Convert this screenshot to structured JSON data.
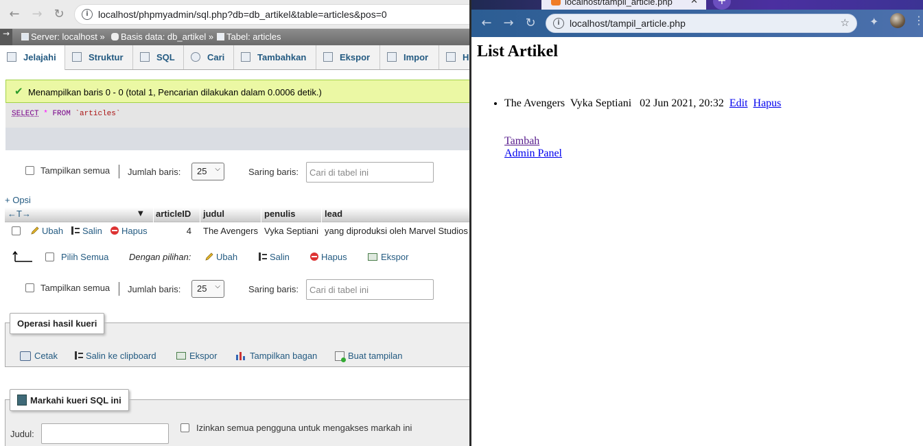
{
  "left_window": {
    "url": "localhost/phpmyadmin/sql.php?db=db_artikel&table=articles&pos=0",
    "breadcrumb": {
      "server": "Server: localhost",
      "database": "Basis data: db_artikel",
      "table": "Tabel: articles"
    },
    "tabs": [
      "Jelajahi",
      "Struktur",
      "SQL",
      "Cari",
      "Tambahkan",
      "Ekspor",
      "Impor",
      "H"
    ],
    "active_tab": "Jelajahi",
    "message": "Menampilkan baris 0 - 0 (total 1, Pencarian dilakukan dalam 0.0006 detik.)",
    "sql": {
      "select": "SELECT",
      "star": "*",
      "from": "FROM",
      "table": "`articles`"
    },
    "nav": {
      "show_all_label": "Tampilkan semua",
      "rows_label": "Jumlah baris:",
      "rows_value": "25",
      "filter_label": "Saring baris:",
      "filter_placeholder": "Cari di tabel ini"
    },
    "options_link": "+ Opsi",
    "columns": [
      "articleID",
      "judul",
      "penulis",
      "lead"
    ],
    "row": {
      "edit": "Ubah",
      "copy": "Salin",
      "delete": "Hapus",
      "articleID": "4",
      "judul": "The Avengers",
      "penulis": "Vyka Septiani",
      "lead": "yang diproduksi oleh Marvel Studios"
    },
    "with_selected": {
      "select_all": "Pilih Semua",
      "label": "Dengan pilihan:",
      "edit": "Ubah",
      "copy": "Salin",
      "delete": "Hapus",
      "export": "Ekspor"
    },
    "query_ops": {
      "legend": "Operasi hasil kueri",
      "print": "Cetak",
      "copy_clipboard": "Salin ke clipboard",
      "export": "Ekspor",
      "chart": "Tampilkan bagan",
      "create_view": "Buat tampilan"
    },
    "bookmark": {
      "legend": "Markahi kueri SQL ini",
      "title_label": "Judul:",
      "allow_all": "Izinkan semua pengguna untuk mengakses markah ini"
    }
  },
  "right_window": {
    "tab_title": "localhost/tampil_article.php",
    "url": "localhost/tampil_article.php",
    "heading": "List Artikel",
    "articles": [
      {
        "title": "The Avengers",
        "author": "Vyka Septiani",
        "date": "02 Jun 2021, 20:32",
        "edit": "Edit",
        "delete": "Hapus"
      }
    ],
    "links": {
      "add": "Tambah",
      "admin": "Admin Panel"
    }
  },
  "colors": {
    "pma_link": "#235a81",
    "success_bg": "#ebf8a4",
    "link_blue": "#0000ee",
    "link_visited": "#551a8b"
  }
}
